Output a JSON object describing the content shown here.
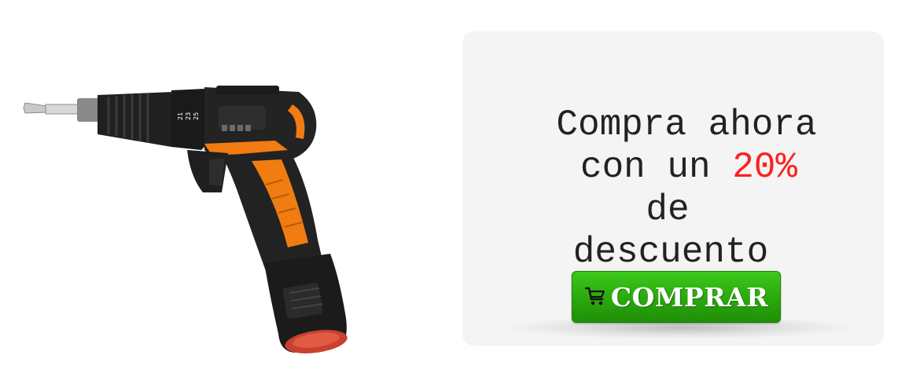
{
  "promo": {
    "line1": "Compra ahora",
    "line2_prefix": "con un ",
    "discount": "20%",
    "line3": "de",
    "line4": "descuento",
    "highlight_color": "#ff2020"
  },
  "button": {
    "icon": "cart-icon",
    "label": "COMPRAR",
    "color": "#2aa80d"
  },
  "product": {
    "icon": "cordless-drill-image",
    "accent_color": "#f07c12",
    "ring_labels": [
      "21",
      "23",
      "25"
    ]
  }
}
